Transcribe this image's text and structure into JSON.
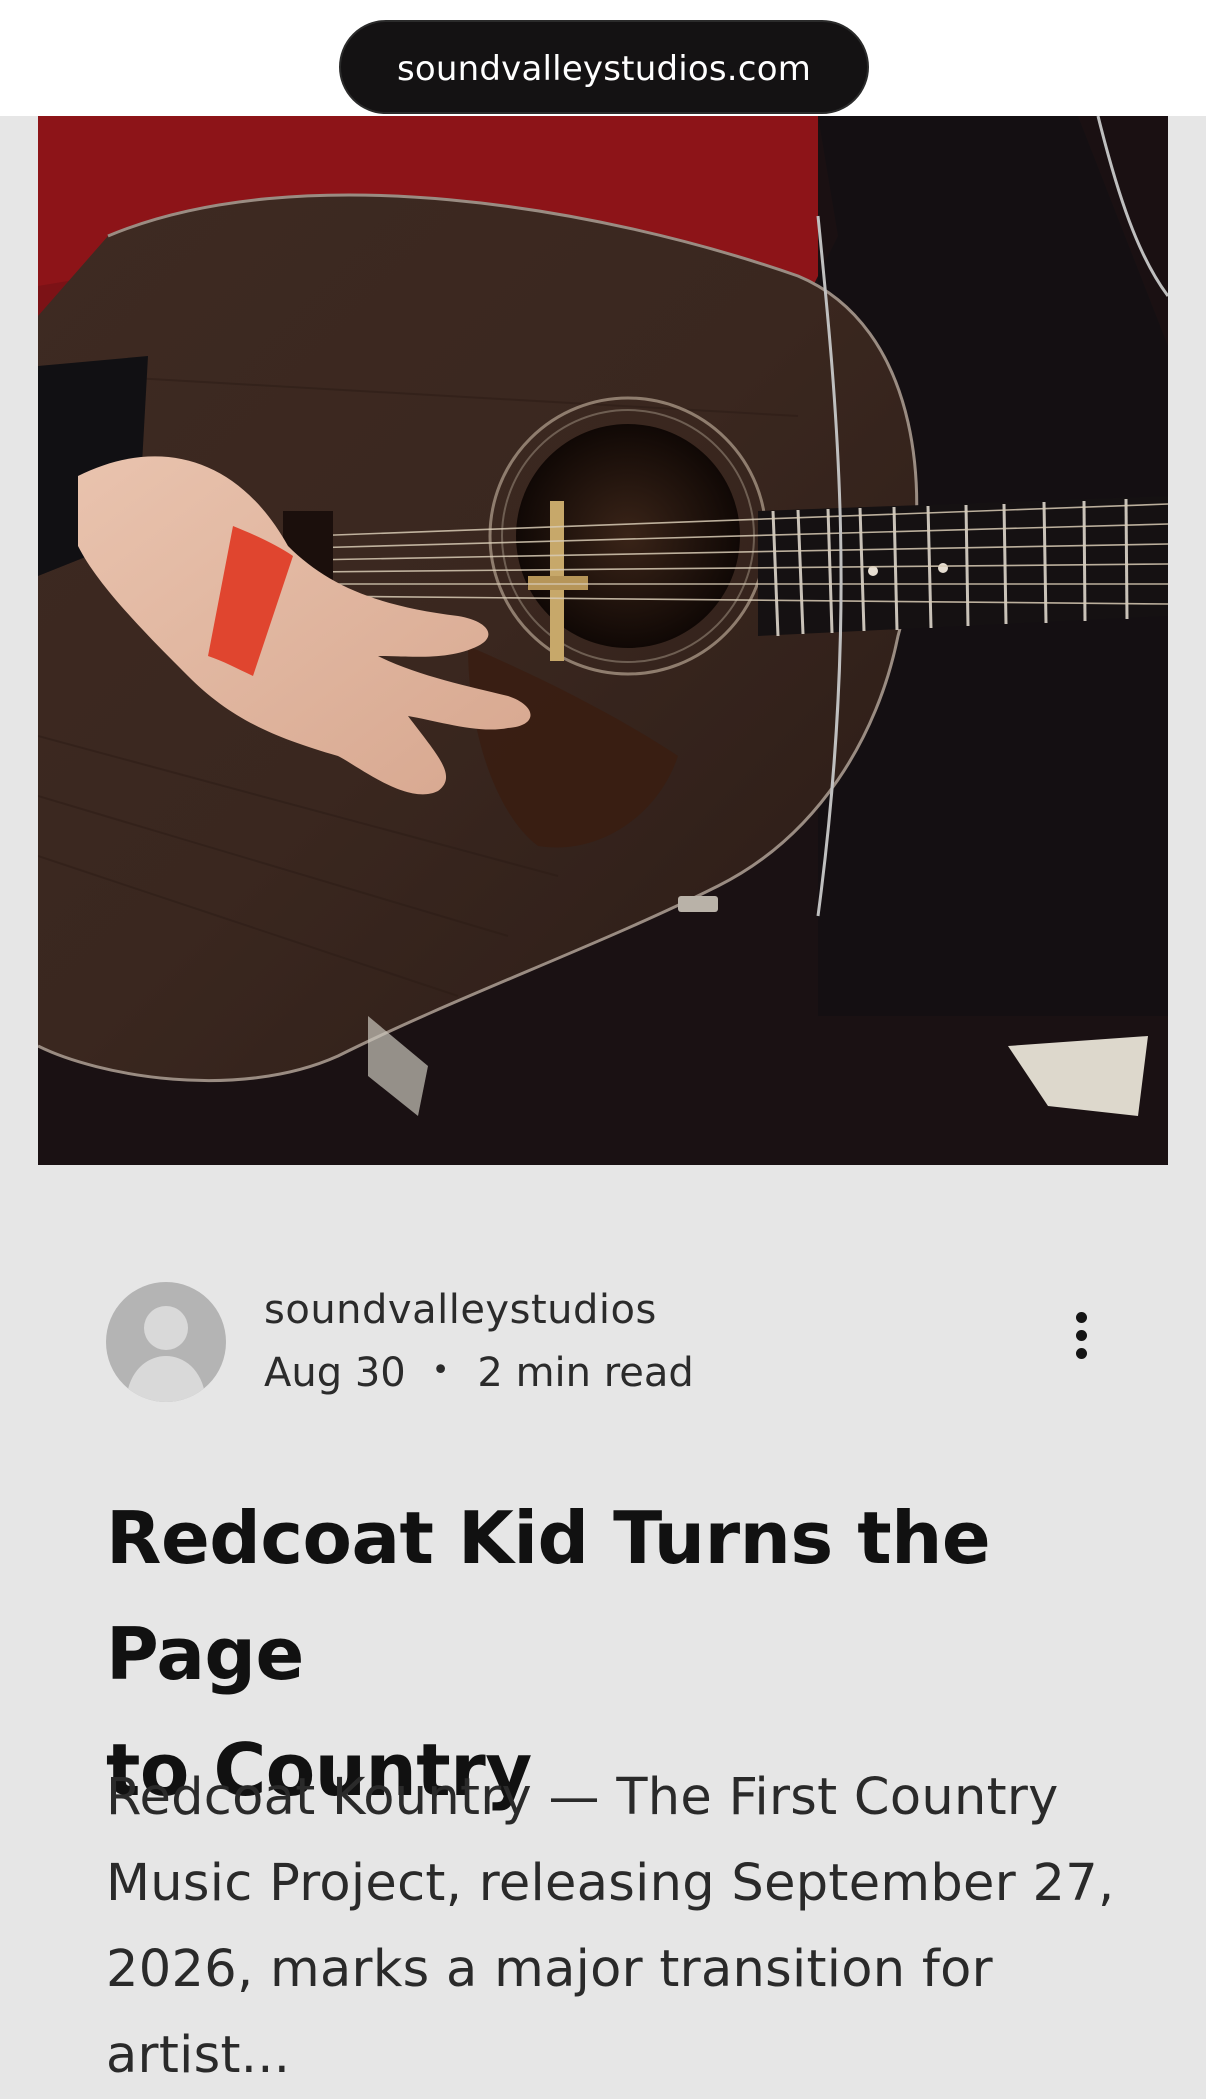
{
  "browser": {
    "url": "soundvalleystudios.com"
  },
  "post": {
    "author": "soundvalleystudios",
    "date": "Aug 30",
    "separator": "•",
    "read_time": "2 min read",
    "title_line1": "Redcoat Kid Turns the Page",
    "title_line2": "to Country",
    "excerpt_line1": "Redcoat Kountry — The First Country",
    "excerpt_line2": "Music Project, releasing September 27,",
    "excerpt_line3": "2026, marks a major transition for artist..."
  },
  "icons": {
    "more": "more-vertical-icon",
    "avatar": "default-user-avatar"
  },
  "colors": {
    "page_background": "#e6e6e6",
    "url_pill": "#141213",
    "title_text": "#111111"
  }
}
